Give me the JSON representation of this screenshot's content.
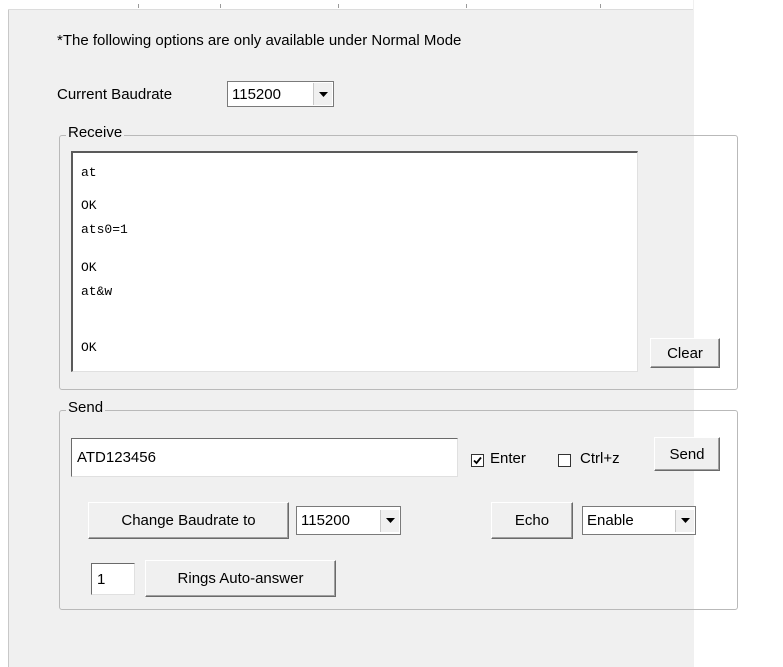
{
  "header": {
    "note": "*The following options are only available under Normal Mode"
  },
  "baudrate": {
    "current_label": "Current Baudrate",
    "current_value": "115200"
  },
  "receive": {
    "legend": "Receive",
    "lines": [
      "at",
      "OK",
      "ats0=1",
      "OK",
      "at&w",
      "OK"
    ],
    "clear_label": "Clear"
  },
  "send": {
    "legend": "Send",
    "input_value": "ATD123456",
    "enter_label": "Enter",
    "enter_checked": true,
    "ctrlz_label": "Ctrl+z",
    "ctrlz_checked": false,
    "send_label": "Send",
    "change_baud_label": "Change Baudrate to",
    "change_baud_value": "115200",
    "echo_label": "Echo",
    "echo_value": "Enable",
    "rings_value": "1",
    "rings_label": "Rings Auto-answer"
  },
  "icons": {
    "dropdown": "chevron-down-icon",
    "check": "checkmark-icon"
  }
}
